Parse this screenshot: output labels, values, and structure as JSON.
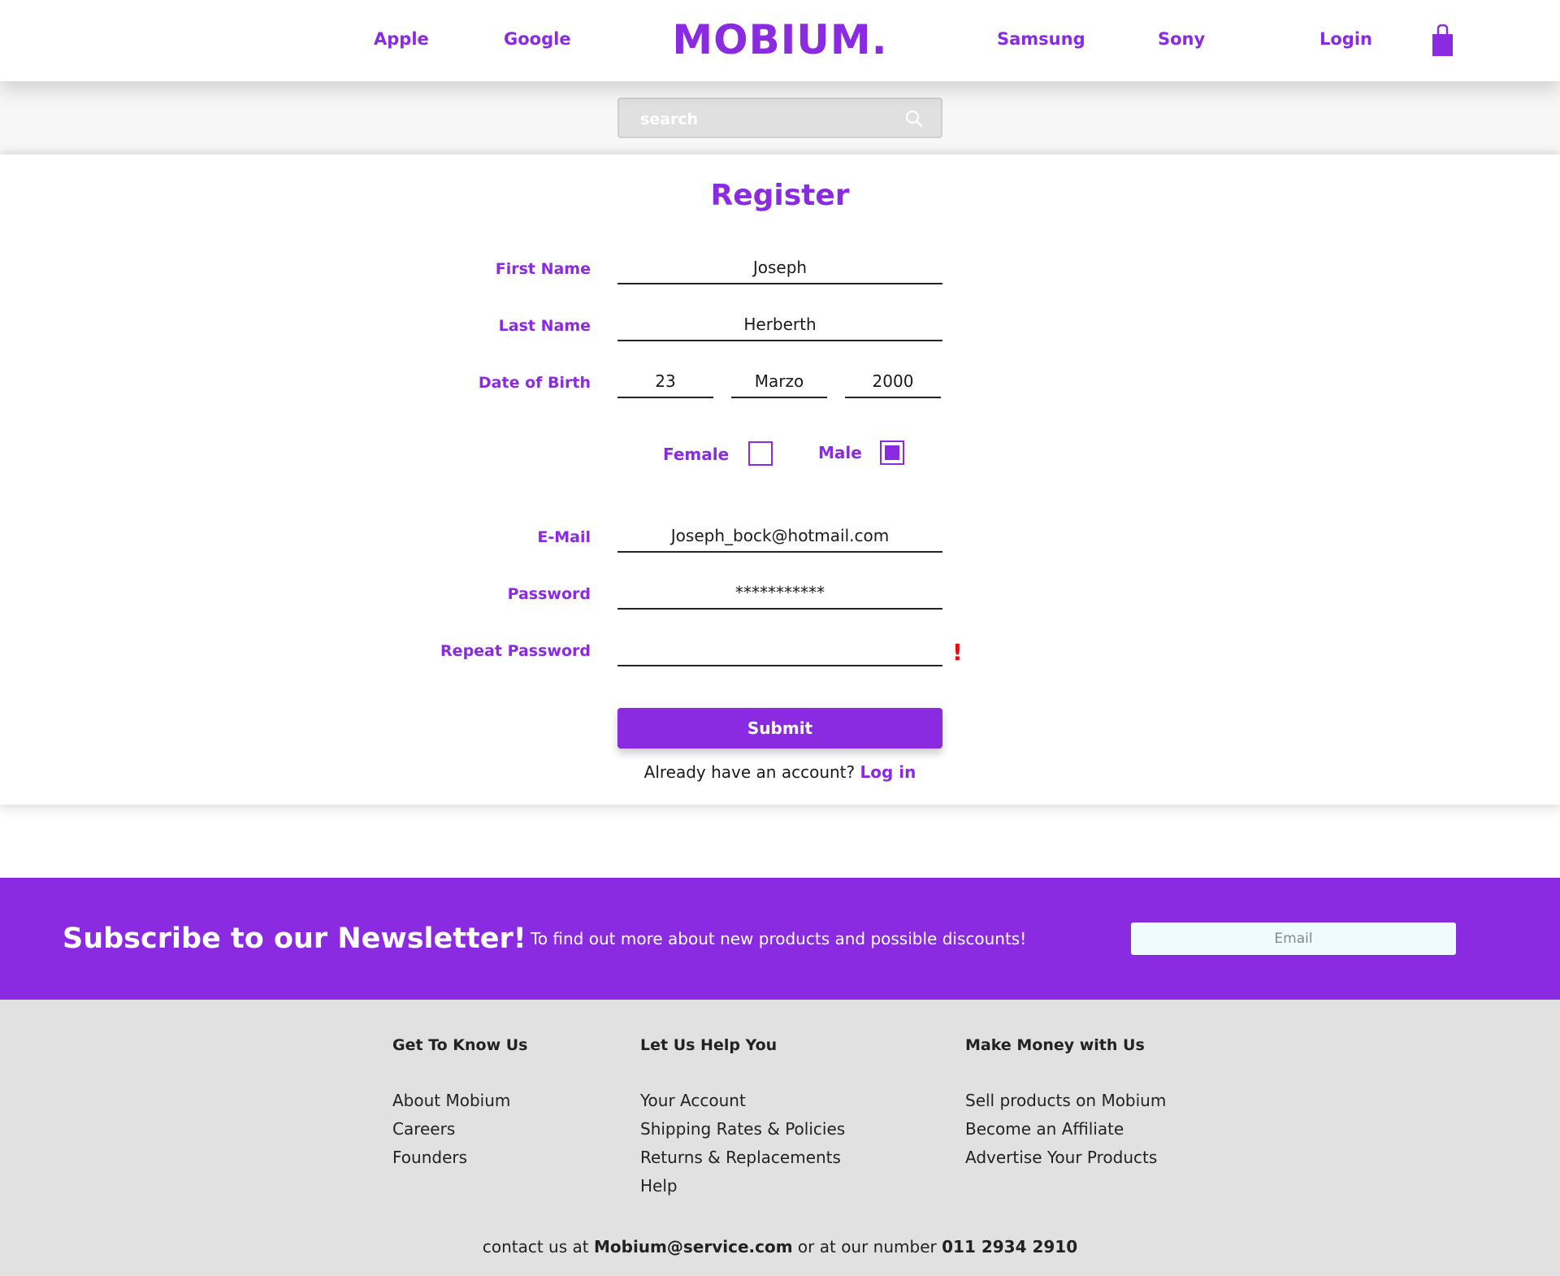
{
  "header": {
    "nav_left": [
      "Apple",
      "Google"
    ],
    "brand": "MOBIUM.",
    "nav_right": [
      "Samsung",
      "Sony"
    ],
    "login": "Login",
    "cart_icon": "shopping-bag-icon",
    "accent_color": "#8a2be2"
  },
  "search": {
    "placeholder": "search",
    "icon": "search-icon"
  },
  "register": {
    "title": "Register",
    "fields": {
      "first_name": {
        "label": "First Name",
        "value": "Joseph"
      },
      "last_name": {
        "label": "Last Name",
        "value": "Herberth"
      },
      "dob": {
        "label": "Date of Birth",
        "day": "23",
        "month": "Marzo",
        "year": "2000"
      },
      "email": {
        "label": "E-Mail",
        "value": "Joseph_bock@hotmail.com"
      },
      "password": {
        "label": "Password",
        "value": "***********"
      },
      "repeat_password": {
        "label": "Repeat Password",
        "value": ""
      }
    },
    "gender": {
      "female": {
        "label": "Female",
        "checked": false
      },
      "male": {
        "label": "Male",
        "checked": true
      }
    },
    "warning": "!",
    "warning_color": "#e01010",
    "submit": "Submit",
    "have_account": "Already have an account?",
    "login_link": "Log in"
  },
  "newsletter": {
    "title": "Subscribe to our Newsletter!",
    "text": "To find out more about new products and possible discounts!",
    "email_placeholder": "Email"
  },
  "footer": {
    "columns": [
      {
        "heading": "Get To Know Us",
        "links": [
          "About Mobium",
          "Careers",
          "Founders"
        ]
      },
      {
        "heading": "Let Us Help You",
        "links": [
          "Your Account",
          "Shipping Rates & Policies",
          "Returns & Replacements",
          "Help"
        ]
      },
      {
        "heading": "Make Money with Us",
        "links": [
          "Sell products on Mobium",
          "Become an Affiliate",
          "Advertise Your Products"
        ]
      }
    ],
    "contact_prefix": "contact us at",
    "contact_email": "Mobium@service.com",
    "contact_middle": "or at our number",
    "contact_phone": "011 2934 2910"
  }
}
